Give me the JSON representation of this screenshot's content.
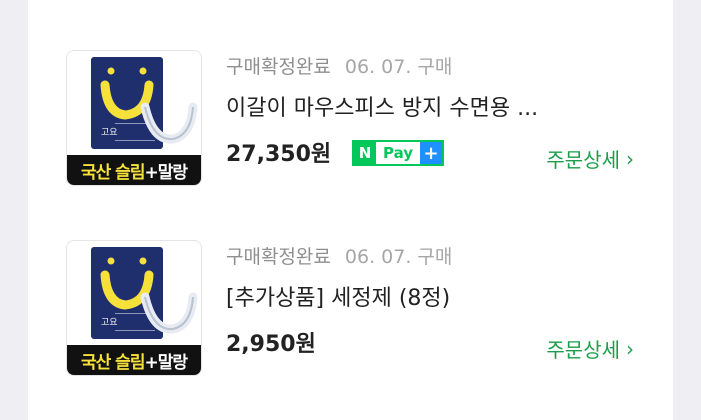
{
  "orders": [
    {
      "status": "구매확정완료",
      "date": "06. 07. 구매",
      "title": "이갈이 마우스피스 방지 수면용 ...",
      "price": "27,350원",
      "pay_badge": {
        "mark": "N",
        "label": "Pay",
        "plus": "+"
      },
      "detail_label": "주문상세",
      "detail_chevron": "›",
      "thumb": {
        "banner_yellow": "국산 슬림",
        "banner_white": "+말랑",
        "pkg_text": "고요"
      }
    },
    {
      "status": "구매확정완료",
      "date": "06. 07. 구매",
      "title": "[추가상품] 세정제 (8정)",
      "price": "2,950원",
      "detail_label": "주문상세",
      "detail_chevron": "›",
      "thumb": {
        "banner_yellow": "국산 슬림",
        "banner_white": "+말랑",
        "pkg_text": "고요"
      }
    }
  ],
  "colors": {
    "background": "#efeff3",
    "card": "#ffffff",
    "accent_green": "#1a9e4a",
    "npay_green": "#03c75a",
    "npay_blue": "#1e90ff"
  }
}
